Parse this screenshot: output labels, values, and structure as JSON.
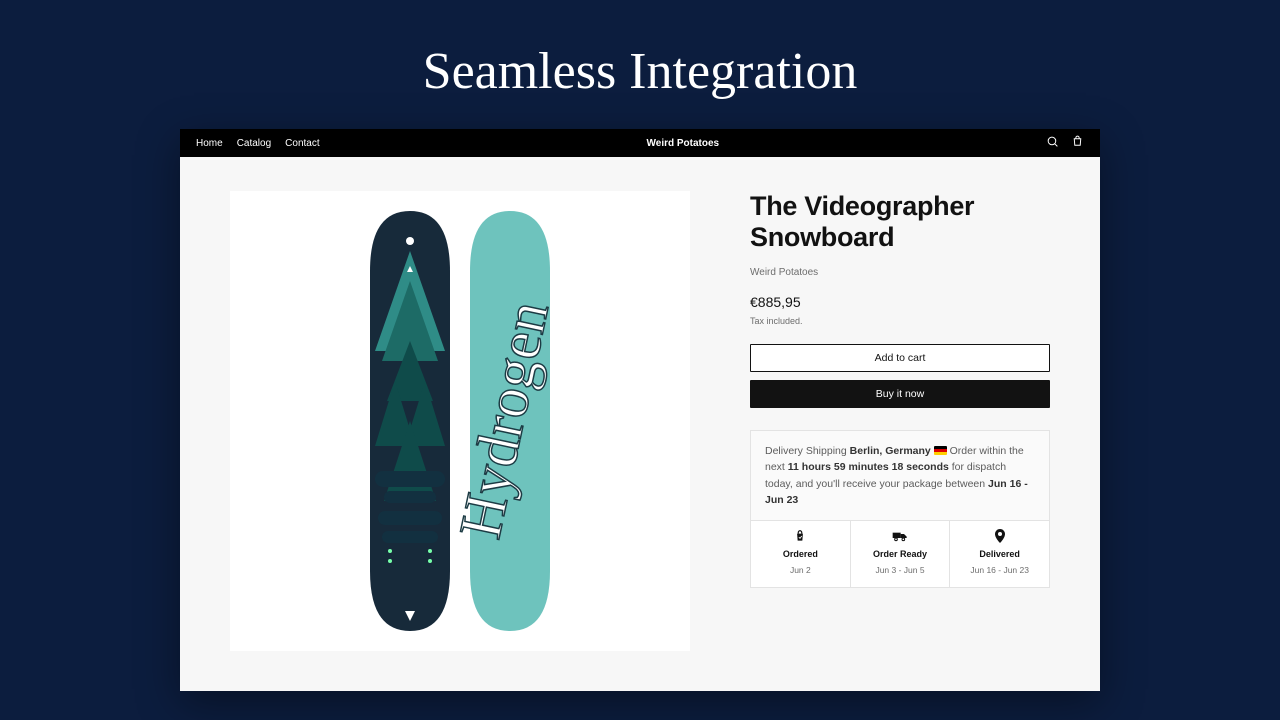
{
  "hero": "Seamless Integration",
  "nav": {
    "home": "Home",
    "catalog": "Catalog",
    "contact": "Contact"
  },
  "store_name": "Weird Potatoes",
  "product": {
    "title": "The Videographer Snowboard",
    "vendor": "Weird Potatoes",
    "price": "€885,95",
    "tax_note": "Tax included.",
    "add_to_cart": "Add to cart",
    "buy_now": "Buy it now",
    "board_text": "Hydrogen"
  },
  "delivery": {
    "prefix": "Delivery Shipping ",
    "location": "Berlin, Germany",
    "mid1": " Order within the next ",
    "countdown": "11 hours 59 minutes 18 seconds",
    "mid2": " for dispatch today, and you'll receive your package between ",
    "range": "Jun 16 - Jun 23",
    "steps": [
      {
        "label": "Ordered",
        "date": "Jun 2"
      },
      {
        "label": "Order Ready",
        "date": "Jun 3 - Jun 5"
      },
      {
        "label": "Delivered",
        "date": "Jun 16 - Jun 23"
      }
    ]
  }
}
